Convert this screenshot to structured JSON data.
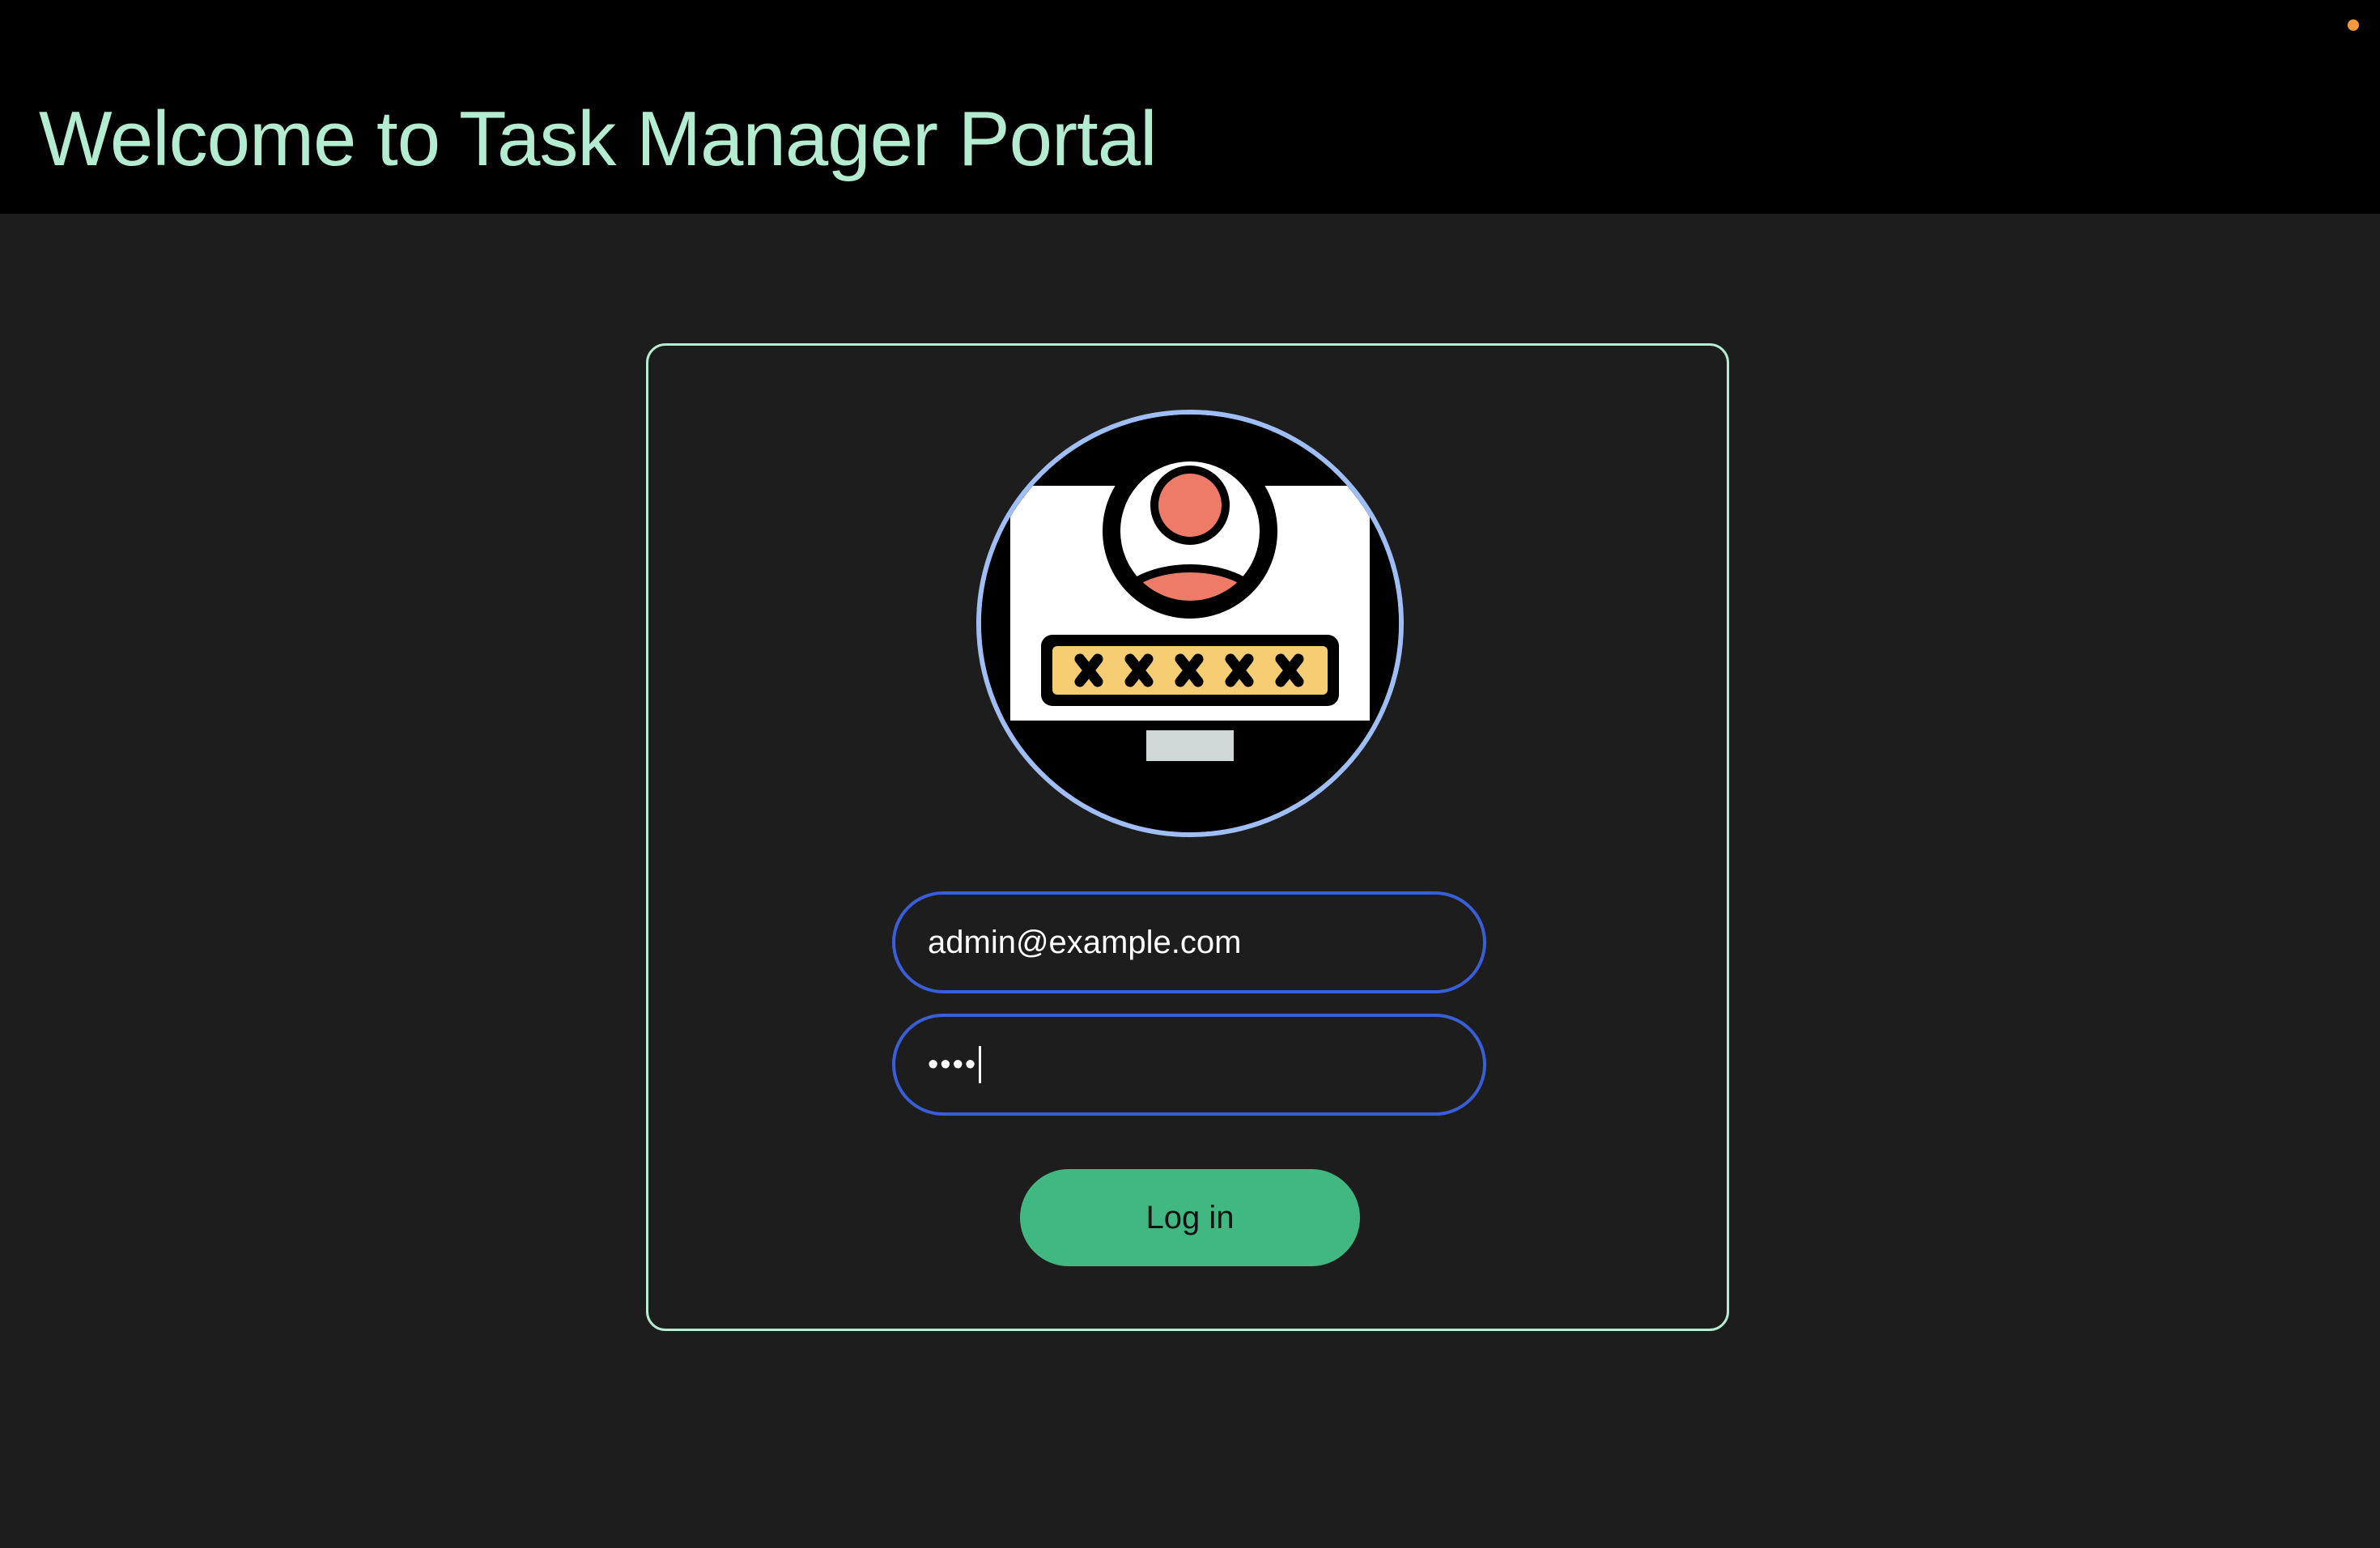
{
  "header": {
    "title": "Welcome to Task Manager Portal"
  },
  "login": {
    "avatar_icon": "user-login-monitor-icon",
    "email_value": "admin@example.com",
    "password_mask": "••••",
    "button_label": "Log in"
  },
  "colors": {
    "header_bg": "#000000",
    "page_bg": "#1d1d1d",
    "title": "#b3ecd1",
    "card_border": "#b6ecd3",
    "input_border": "#3a5ed8",
    "avatar_ring": "#9fbef5",
    "button": "#41b882",
    "status_dot": "#f59a3c"
  }
}
